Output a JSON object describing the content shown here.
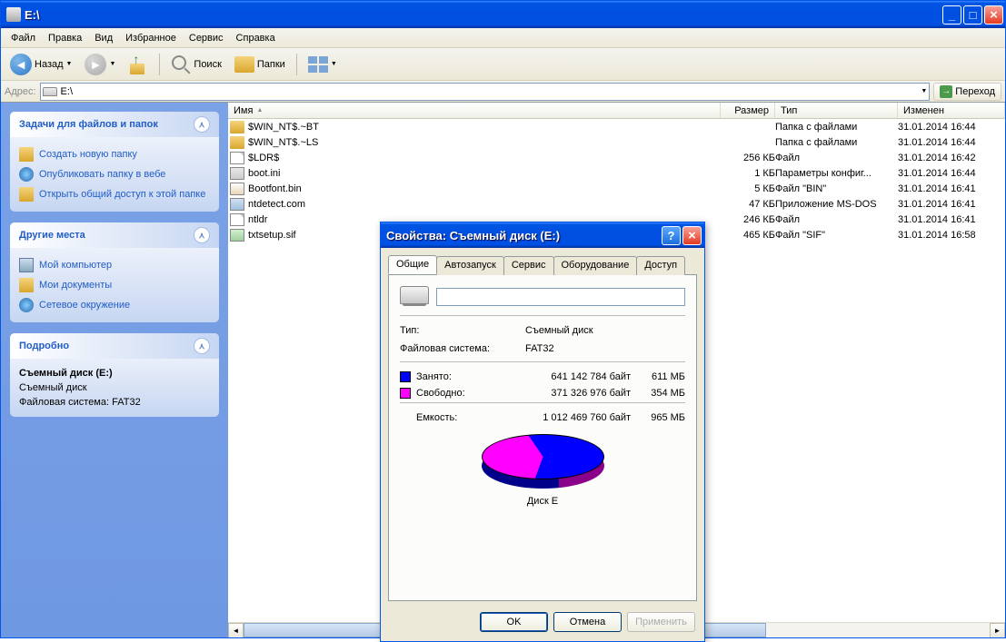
{
  "window": {
    "title": "E:\\"
  },
  "menu": {
    "file": "Файл",
    "edit": "Правка",
    "view": "Вид",
    "favorites": "Избранное",
    "tools": "Сервис",
    "help": "Справка"
  },
  "toolbar": {
    "back": "Назад",
    "search": "Поиск",
    "folders": "Папки"
  },
  "address": {
    "label": "Адрес:",
    "value": "E:\\",
    "go": "Переход"
  },
  "columns": {
    "name": "Имя",
    "size": "Размер",
    "type": "Тип",
    "modified": "Изменен"
  },
  "files": [
    {
      "name": "$WIN_NT$.~BT",
      "size": "",
      "type": "Папка с файлами",
      "date": "31.01.2014 16:44",
      "icon": "folder"
    },
    {
      "name": "$WIN_NT$.~LS",
      "size": "",
      "type": "Папка с файлами",
      "date": "31.01.2014 16:44",
      "icon": "folder"
    },
    {
      "name": "$LDR$",
      "size": "256 КБ",
      "type": "Файл",
      "date": "31.01.2014 16:42",
      "icon": "file"
    },
    {
      "name": "boot.ini",
      "size": "1 КБ",
      "type": "Параметры конфиг...",
      "date": "31.01.2014 16:44",
      "icon": "ini"
    },
    {
      "name": "Bootfont.bin",
      "size": "5 КБ",
      "type": "Файл \"BIN\"",
      "date": "31.01.2014 16:41",
      "icon": "bin"
    },
    {
      "name": "ntdetect.com",
      "size": "47 КБ",
      "type": "Приложение MS-DOS",
      "date": "31.01.2014 16:41",
      "icon": "com"
    },
    {
      "name": "ntldr",
      "size": "246 КБ",
      "type": "Файл",
      "date": "31.01.2014 16:41",
      "icon": "file"
    },
    {
      "name": "txtsetup.sif",
      "size": "465 КБ",
      "type": "Файл \"SIF\"",
      "date": "31.01.2014 16:58",
      "icon": "sif"
    }
  ],
  "sidebar": {
    "tasks": {
      "title": "Задачи для файлов и папок",
      "items": [
        "Создать новую папку",
        "Опубликовать папку в вебе",
        "Открыть общий доступ к этой папке"
      ]
    },
    "places": {
      "title": "Другие места",
      "items": [
        "Мой компьютер",
        "Мои документы",
        "Сетевое окружение"
      ]
    },
    "details": {
      "title": "Подробно",
      "drive_name": "Съемный диск (E:)",
      "drive_type": "Съемный диск",
      "filesystem": "Файловая система: FAT32"
    }
  },
  "dialog": {
    "title": "Свойства: Съемный диск (E:)",
    "tabs": {
      "general": "Общие",
      "autorun": "Автозапуск",
      "tools": "Сервис",
      "hardware": "Оборудование",
      "sharing": "Доступ"
    },
    "type_label": "Тип:",
    "type_value": "Съемный диск",
    "fs_label": "Файловая система:",
    "fs_value": "FAT32",
    "used_label": "Занято:",
    "used_bytes": "641 142 784 байт",
    "used_mb": "611 МБ",
    "free_label": "Свободно:",
    "free_bytes": "371 326 976 байт",
    "free_mb": "354 МБ",
    "cap_label": "Емкость:",
    "cap_bytes": "1 012 469 760 байт",
    "cap_mb": "965 МБ",
    "disk_label": "Диск E",
    "ok": "OK",
    "cancel": "Отмена",
    "apply": "Применить"
  },
  "chart_data": {
    "type": "pie",
    "title": "Диск E",
    "series": [
      {
        "name": "Занято",
        "value": 641142784,
        "display": "611 МБ",
        "color": "#0000ff"
      },
      {
        "name": "Свободно",
        "value": 371326976,
        "display": "354 МБ",
        "color": "#ff00ff"
      }
    ],
    "total": {
      "label": "Емкость",
      "value": 1012469760,
      "display": "965 МБ"
    }
  }
}
